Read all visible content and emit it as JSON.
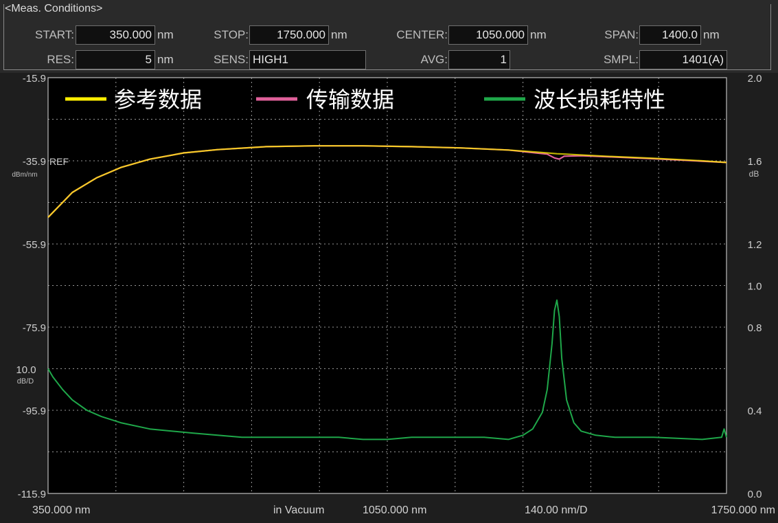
{
  "conditions": {
    "title": "<Meas. Conditions>",
    "start_label": "START:",
    "start_value": "350.000",
    "start_unit": "nm",
    "stop_label": "STOP:",
    "stop_value": "1750.000",
    "stop_unit": "nm",
    "center_label": "CENTER:",
    "center_value": "1050.000",
    "center_unit": "nm",
    "span_label": "SPAN:",
    "span_value": "1400.0",
    "span_unit": "nm",
    "res_label": "RES:",
    "res_value": "5",
    "res_unit": "nm",
    "sens_label": "SENS:",
    "sens_value": "HIGH1",
    "avg_label": "AVG:",
    "avg_value": "1",
    "smpl_label": "SMPL:",
    "smpl_value": "1401(A)"
  },
  "colors": {
    "reference": "#ffee00",
    "transmission": "#e0609a",
    "loss": "#1fa84a",
    "grid": "#9a9a9a",
    "plot_bg": "#000000"
  },
  "chart_data": {
    "type": "line",
    "legend_position": "top",
    "grid": true,
    "x_label": "in Vacuum",
    "x_tick_labels": {
      "start": "350.000 nm",
      "center": "1050.000 nm",
      "div": "140.00 nm/D",
      "stop": "1750.000 nm"
    },
    "x_range": [
      350,
      1750
    ],
    "left_axis": {
      "range": [
        -115.9,
        -15.9
      ],
      "ticks": [
        "-15.9",
        "-35.9",
        "-55.9",
        "-75.9",
        "-95.9",
        "-115.9"
      ],
      "ref_label": "REF",
      "unit": "dBm/nm",
      "scale_value": "10.0",
      "scale_unit": "dB/D"
    },
    "right_axis": {
      "range": [
        0.0,
        2.0
      ],
      "ticks": [
        "2.0",
        "1.6",
        "1.2",
        "1.0",
        "0.8",
        "0.4",
        "0.0"
      ],
      "unit": "dB"
    },
    "series": [
      {
        "name": "参考数据",
        "axis": "left",
        "x": [
          350,
          400,
          450,
          500,
          560,
          630,
          700,
          800,
          900,
          1000,
          1100,
          1200,
          1300,
          1380,
          1400,
          1420,
          1450,
          1500,
          1600,
          1700,
          1750
        ],
        "y": [
          -49.5,
          -43.5,
          -40.0,
          -37.5,
          -35.5,
          -34.0,
          -33.2,
          -32.5,
          -32.3,
          -32.3,
          -32.5,
          -32.8,
          -33.3,
          -34.0,
          -34.2,
          -34.3,
          -34.5,
          -34.8,
          -35.3,
          -35.9,
          -36.3
        ]
      },
      {
        "name": "传输数据",
        "axis": "left",
        "x": [
          350,
          400,
          450,
          500,
          560,
          630,
          700,
          800,
          900,
          1000,
          1100,
          1200,
          1300,
          1380,
          1395,
          1405,
          1415,
          1450,
          1500,
          1600,
          1700,
          1750
        ],
        "y": [
          -49.5,
          -43.5,
          -40.0,
          -37.5,
          -35.5,
          -34.0,
          -33.2,
          -32.5,
          -32.3,
          -32.3,
          -32.5,
          -32.8,
          -33.3,
          -34.3,
          -35.2,
          -35.5,
          -34.8,
          -34.7,
          -34.9,
          -35.4,
          -36.0,
          -36.3
        ]
      },
      {
        "name": "波长损耗特性",
        "axis": "right",
        "x": [
          350,
          360,
          380,
          400,
          430,
          460,
          500,
          560,
          650,
          750,
          850,
          950,
          1000,
          1050,
          1100,
          1150,
          1200,
          1250,
          1300,
          1330,
          1350,
          1370,
          1380,
          1390,
          1395,
          1400,
          1405,
          1410,
          1420,
          1435,
          1450,
          1480,
          1520,
          1600,
          1700,
          1740,
          1745,
          1750
        ],
        "y": [
          0.6,
          0.56,
          0.5,
          0.45,
          0.4,
          0.37,
          0.34,
          0.31,
          0.29,
          0.27,
          0.27,
          0.27,
          0.26,
          0.26,
          0.27,
          0.27,
          0.27,
          0.27,
          0.26,
          0.28,
          0.31,
          0.39,
          0.5,
          0.72,
          0.88,
          0.93,
          0.85,
          0.65,
          0.45,
          0.34,
          0.3,
          0.28,
          0.27,
          0.27,
          0.26,
          0.27,
          0.31,
          0.27
        ]
      }
    ]
  }
}
